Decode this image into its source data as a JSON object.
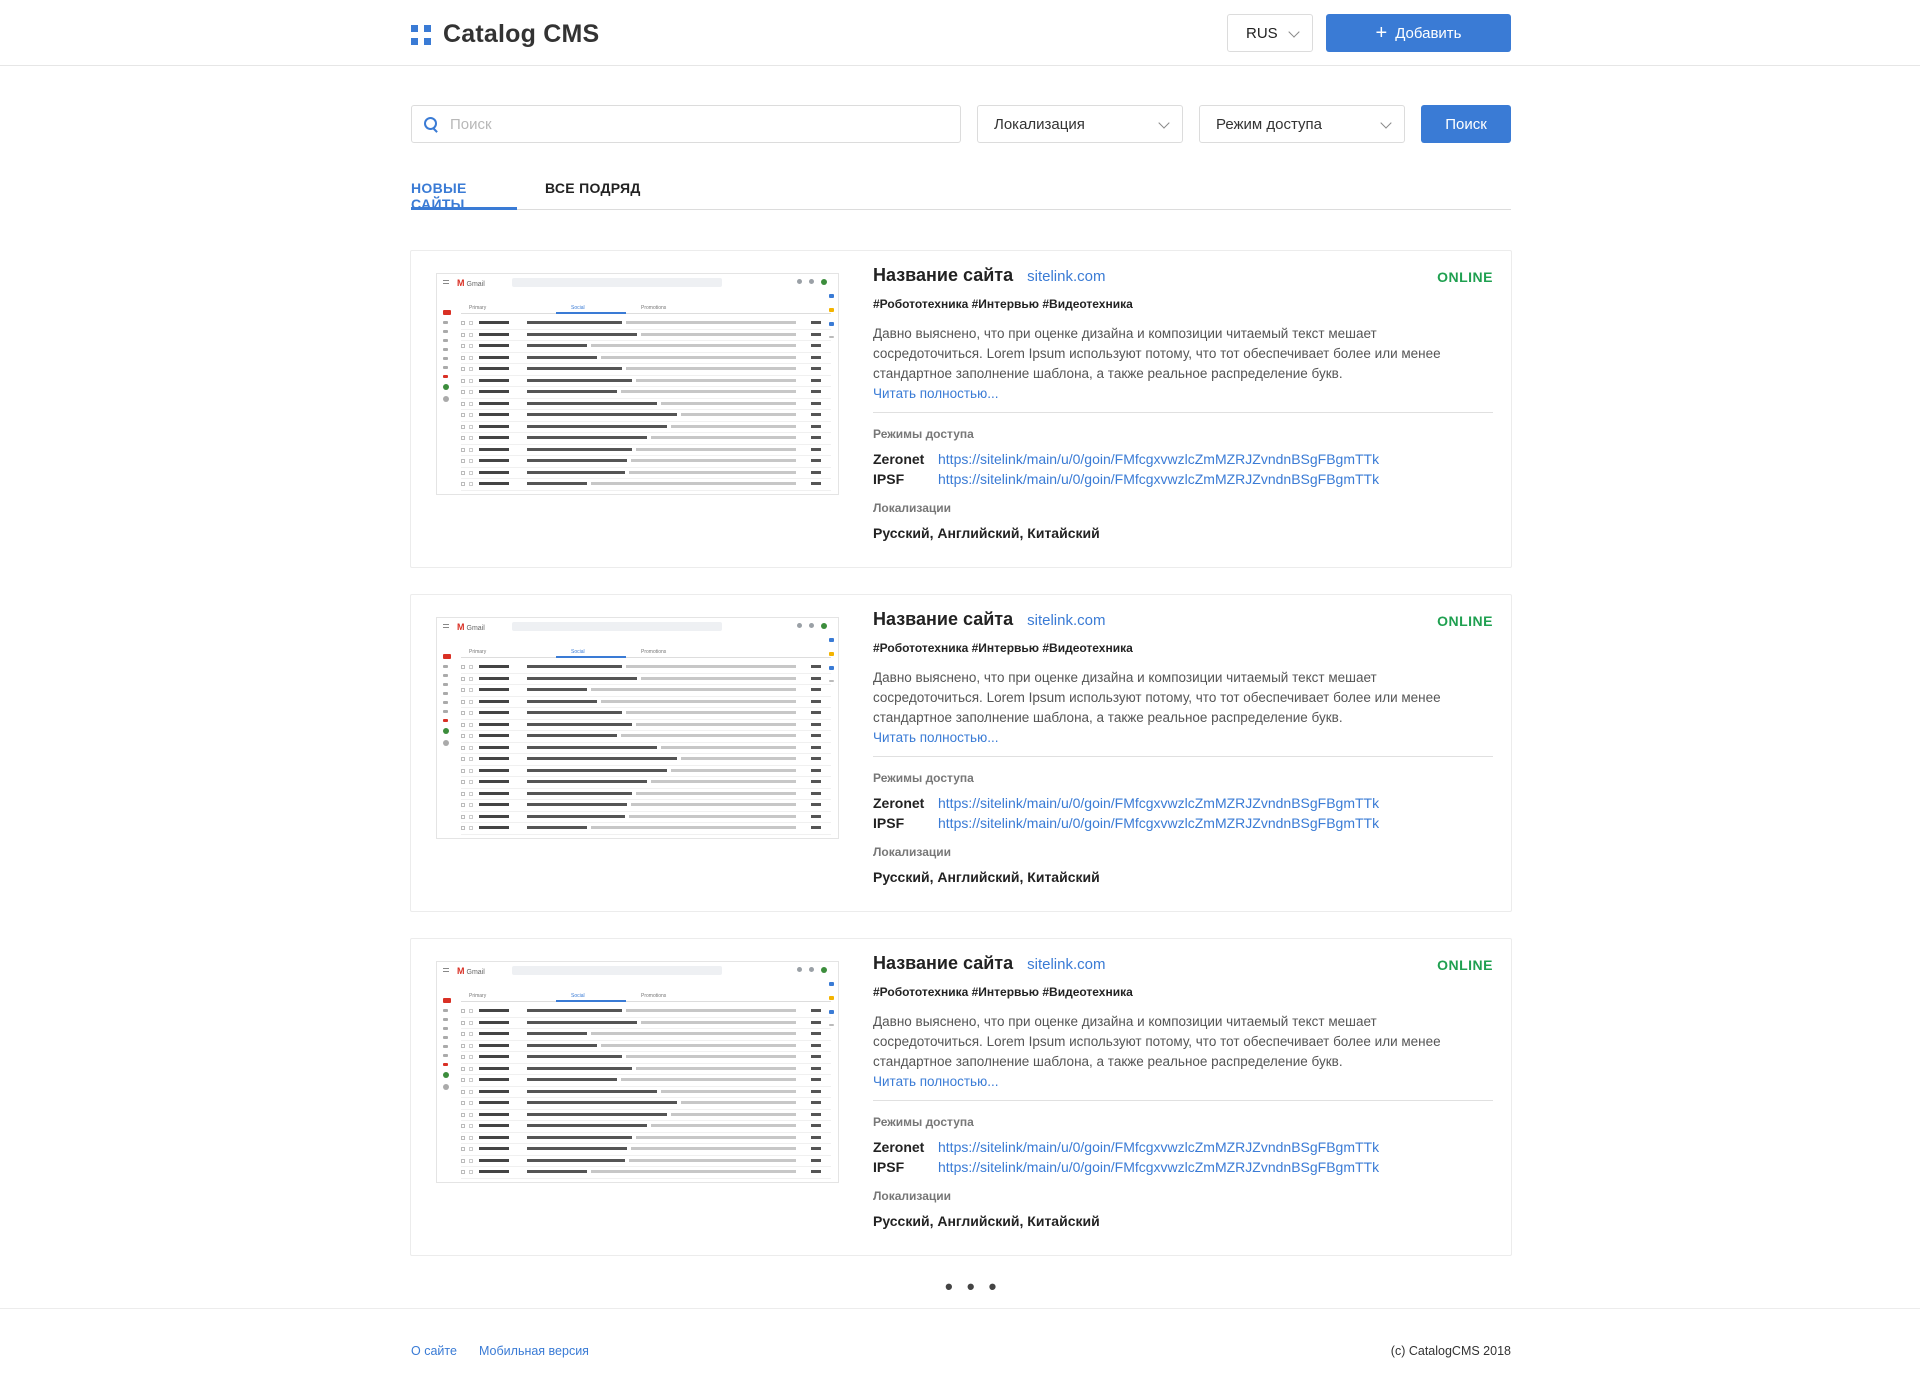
{
  "header": {
    "logo_text": "Catalog CMS",
    "lang": "RUS",
    "add_label": "Добавить"
  },
  "filters": {
    "search_placeholder": "Поиск",
    "localization": "Локализация",
    "access_mode": "Режим доступа",
    "search_button": "Поиск"
  },
  "tabs": [
    {
      "label": "НОВЫЕ САЙТЫ",
      "active": true
    },
    {
      "label": "ВСЕ ПОДРЯД",
      "active": false
    }
  ],
  "cards": [
    {
      "title": "Название сайта",
      "link": "sitelink.com",
      "status": "ONLINE",
      "tags": "#Робототехника #Интервью #Видеотехника",
      "description": "Давно выяснено, что при оценке дизайна и композиции читаемый текст мешает сосредоточиться. Lorem Ipsum используют потому, что тот обеспечивает более или менее стандартное заполнение шаблона, а также реальное распределение букв.",
      "read_more": "Читать полностью...",
      "access_label": "Режимы доступа",
      "access": [
        {
          "name": "Zeronet",
          "url": "https://sitelink/main/u/0/goin/FMfcgxvwzlcZmMZRJZvndnBSgFBgmTTk"
        },
        {
          "name": "IPSF",
          "url": "https://sitelink/main/u/0/goin/FMfcgxvwzlcZmMZRJZvndnBSgFBgmTTk"
        }
      ],
      "loc_label": "Локализации",
      "languages": "Русский, Английский, Китайский"
    },
    {
      "title": "Название сайта",
      "link": "sitelink.com",
      "status": "ONLINE",
      "tags": "#Робототехника #Интервью #Видеотехника",
      "description": "Давно выяснено, что при оценке дизайна и композиции читаемый текст мешает сосредоточиться. Lorem Ipsum используют потому, что тот обеспечивает более или менее стандартное заполнение шаблона, а также реальное распределение букв.",
      "read_more": "Читать полностью...",
      "access_label": "Режимы доступа",
      "access": [
        {
          "name": "Zeronet",
          "url": "https://sitelink/main/u/0/goin/FMfcgxvwzlcZmMZRJZvndnBSgFBgmTTk"
        },
        {
          "name": "IPSF",
          "url": "https://sitelink/main/u/0/goin/FMfcgxvwzlcZmMZRJZvndnBSgFBgmTTk"
        }
      ],
      "loc_label": "Локализации",
      "languages": "Русский, Английский, Китайский"
    },
    {
      "title": "Название сайта",
      "link": "sitelink.com",
      "status": "ONLINE",
      "tags": "#Робототехника #Интервью #Видеотехника",
      "description": "Давно выяснено, что при оценке дизайна и композиции читаемый текст мешает сосредоточиться. Lorem Ipsum используют потому, что тот обеспечивает более или менее стандартное заполнение шаблона, а также реальное распределение букв.",
      "read_more": "Читать полностью...",
      "access_label": "Режимы доступа",
      "access": [
        {
          "name": "Zeronet",
          "url": "https://sitelink/main/u/0/goin/FMfcgxvwzlcZmMZRJZvndnBSgFBgmTTk"
        },
        {
          "name": "IPSF",
          "url": "https://sitelink/main/u/0/goin/FMfcgxvwzlcZmMZRJZvndnBSgFBgmTTk"
        }
      ],
      "loc_label": "Локализации",
      "languages": "Русский, Английский, Китайский"
    }
  ],
  "pagination": {
    "more": "• • •"
  },
  "footer": {
    "about": "О сайте",
    "mobile": "Мобильная версия",
    "copyright": "(c) CatalogCMS 2018"
  },
  "colors": {
    "accent": "#3a7bd5",
    "online": "#1fa050"
  },
  "icons": {
    "logo": "grid-dots-icon",
    "add": "plus-icon",
    "search": "search-icon",
    "select": "chevron-down-icon",
    "thumbnail": "site-screenshot-thumbnail"
  }
}
